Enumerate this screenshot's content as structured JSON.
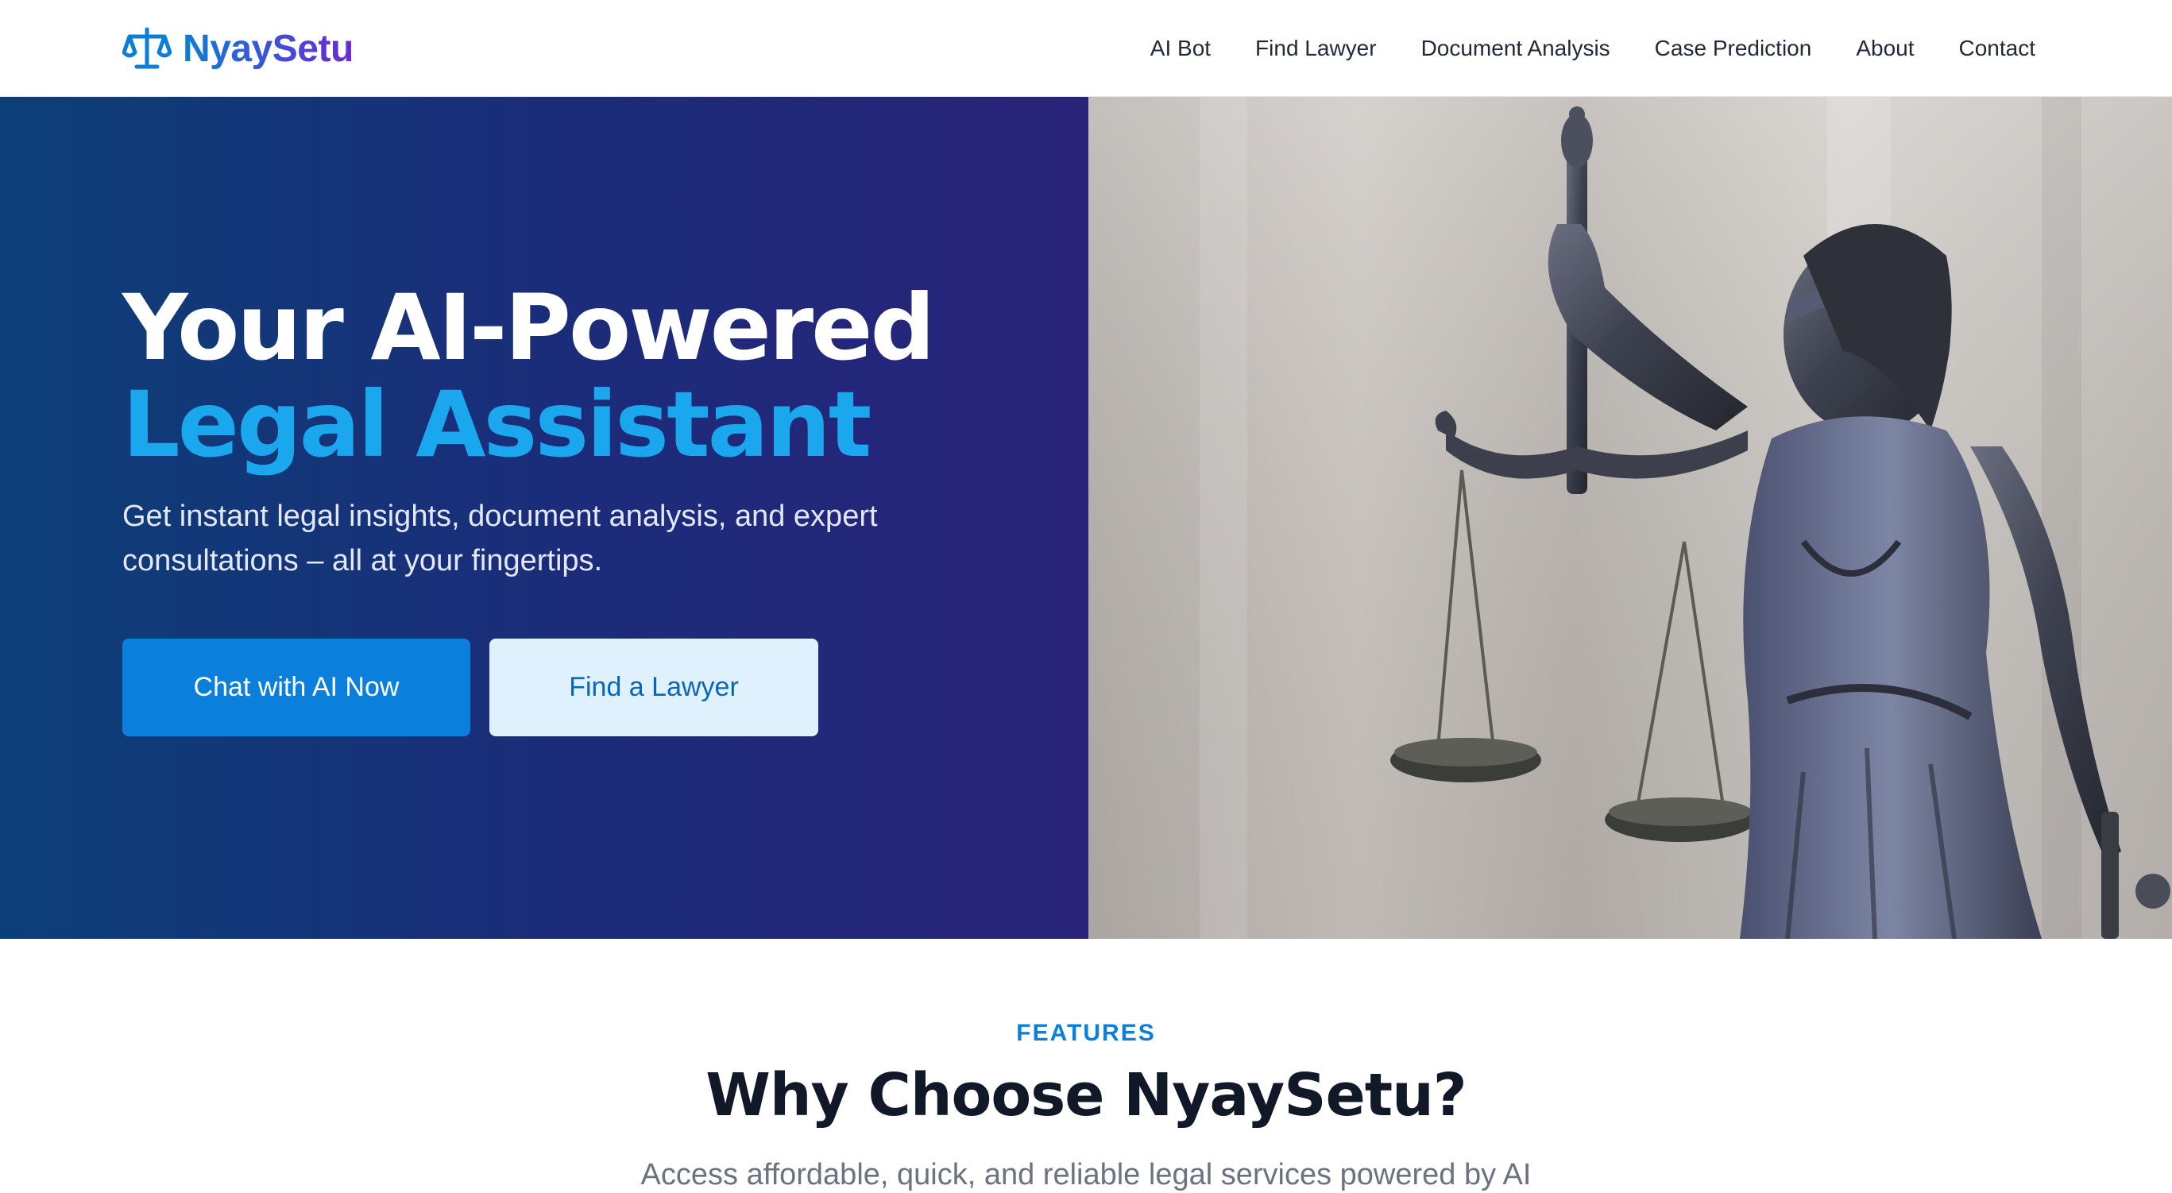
{
  "brand": {
    "name": "NyaySetu",
    "icon": "scales-icon",
    "gradient": [
      "#0b7fd6",
      "#6d28d9"
    ]
  },
  "nav": [
    {
      "label": "AI Bot"
    },
    {
      "label": "Find Lawyer"
    },
    {
      "label": "Document Analysis"
    },
    {
      "label": "Case Prediction"
    },
    {
      "label": "About"
    },
    {
      "label": "Contact"
    }
  ],
  "hero": {
    "title_line1": "Your AI-Powered",
    "title_line2": "Legal Assistant",
    "subtitle": "Get instant legal insights, document analysis, and expert consultations – all at your fingertips.",
    "primary_button": "Chat with AI Now",
    "secondary_button": "Find a Lawyer",
    "image_icon": "lady-justice-statue",
    "colors": {
      "accent": "#1aa7ee",
      "primary_button": "#0a7fdc",
      "secondary_button": "#dff1fd"
    }
  },
  "features": {
    "label": "FEATURES",
    "title": "Why Choose NyaySetu?",
    "subtitle": "Access affordable, quick, and reliable legal services powered by AI"
  }
}
